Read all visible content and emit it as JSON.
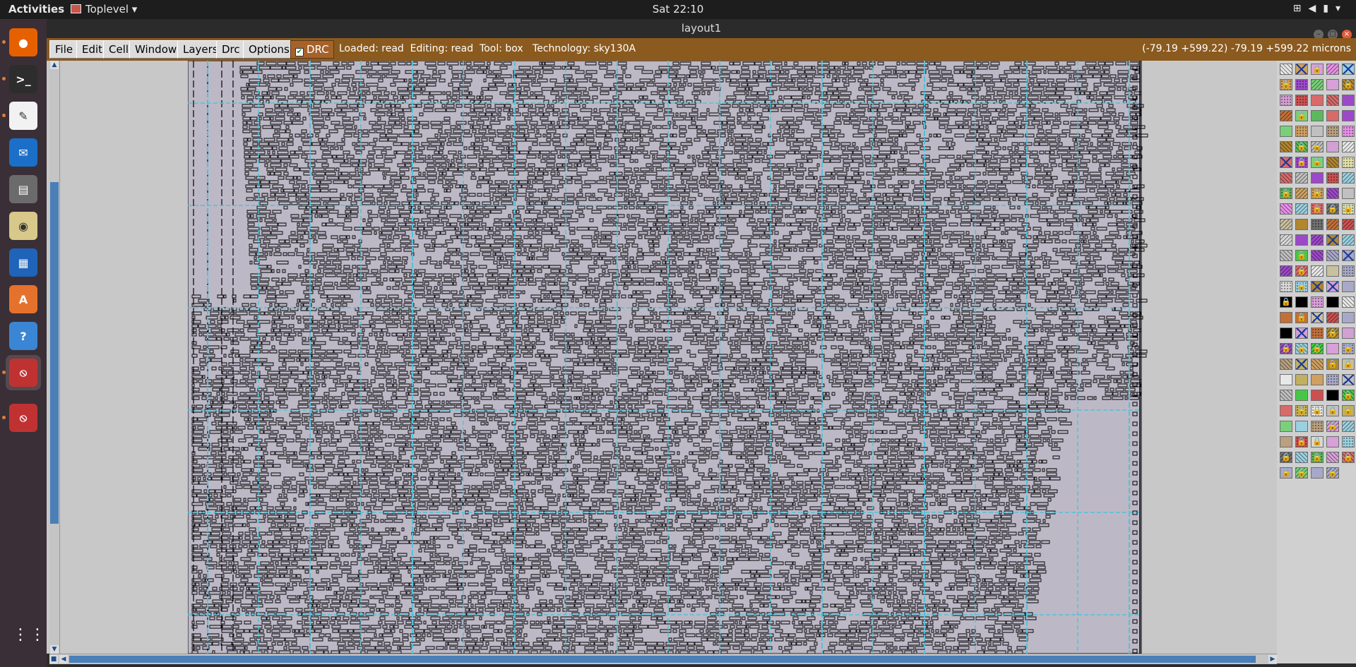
{
  "topbar": {
    "activities": "Activities",
    "app_menu": "Toplevel ▾",
    "clock": "Sat 22:10",
    "tray_icons": [
      "network-icon",
      "volume-icon",
      "battery-icon",
      "power-menu-icon"
    ]
  },
  "dock": {
    "apps": [
      {
        "name": "firefox",
        "color": "#e66000",
        "running": true
      },
      {
        "name": "terminal",
        "color": "#2d2d2d",
        "running": true
      },
      {
        "name": "text-editor",
        "color": "#f2f2f2",
        "running": true
      },
      {
        "name": "thunderbird",
        "color": "#1c6fc8",
        "running": false
      },
      {
        "name": "files",
        "color": "#6b6b6b",
        "running": false
      },
      {
        "name": "rhythmbox",
        "color": "#d8c88a",
        "running": false
      },
      {
        "name": "libreoffice-writer",
        "color": "#1f64b8",
        "running": false
      },
      {
        "name": "software-center",
        "color": "#e5722c",
        "running": false
      },
      {
        "name": "help",
        "color": "#3a86d4",
        "running": false
      },
      {
        "name": "magic-window",
        "color": "#c03232",
        "running": true
      },
      {
        "name": "magic-window-2",
        "color": "#c03232",
        "running": true
      }
    ],
    "apps_grid_glyph": "⋮⋮⋮"
  },
  "window": {
    "title": "layout1",
    "menus": [
      "File",
      "Edit",
      "Cell",
      "Window",
      "Layers",
      "Drc",
      "Options"
    ],
    "drc_label": "DRC",
    "drc_checked": true,
    "status": "Loaded: read  Editing: read  Tool: box   Technology: sky130A",
    "coordinates": "(-79.19 +599.22) -79.19 +599.22 microns"
  },
  "palette": {
    "rows": 27,
    "cols": 5,
    "locked_marker": "🔒"
  },
  "colors": {
    "menubar": "#8b5a1e",
    "canvas_bg": "#c8c8c8",
    "cell_fill": "#bdb8c6",
    "grid_lines": "#4fc3d9",
    "scroll_thumb": "#4a7fb8"
  }
}
